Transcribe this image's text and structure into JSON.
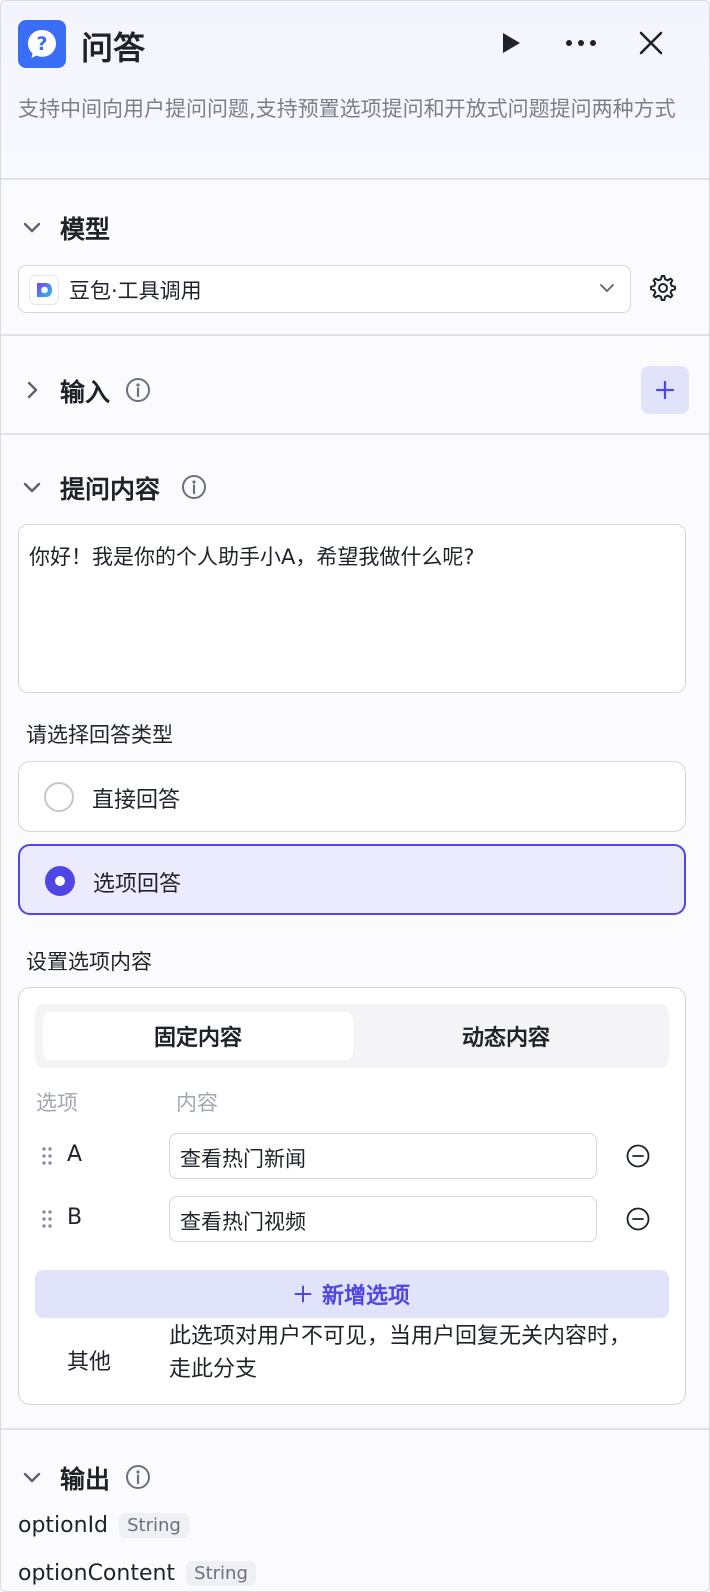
{
  "header": {
    "title": "问答",
    "description": "支持中间向用户提问问题,支持预置选项提问和开放式问题提问两种方式"
  },
  "model_section": {
    "title": "模型",
    "selected_model": "豆包·工具调用"
  },
  "input_section": {
    "title": "输入"
  },
  "question_section": {
    "title": "提问内容",
    "question_text": "你好！我是你的个人助手小A，希望我做什么呢?",
    "answer_type_label": "请选择回答类型",
    "answer_types": [
      "直接回答",
      "选项回答"
    ],
    "selected_answer_type": "选项回答",
    "options_label": "设置选项内容",
    "tabs": [
      "固定内容",
      "动态内容"
    ],
    "active_tab": "固定内容",
    "columns": [
      "选项",
      "内容"
    ],
    "options": [
      {
        "key": "A",
        "content": "查看热门新闻"
      },
      {
        "key": "B",
        "content": "查看热门视频"
      }
    ],
    "add_option_label": "新增选项",
    "other_key": "其他",
    "other_desc": "此选项对用户不可见，当用户回复无关内容时，走此分支"
  },
  "output_section": {
    "title": "输出",
    "fields": [
      {
        "name": "optionId",
        "type": "String"
      },
      {
        "name": "optionContent",
        "type": "String"
      }
    ]
  },
  "colors": {
    "accent": "#5046e5",
    "logo_blue": "#3b6ef6"
  },
  "icons": [
    "question-icon",
    "play-icon",
    "more-icon",
    "close-icon",
    "chevron-down-icon",
    "chevron-right-icon",
    "info-icon",
    "gear-icon",
    "plus-icon",
    "drag-handle-icon",
    "minus-circle-icon"
  ]
}
